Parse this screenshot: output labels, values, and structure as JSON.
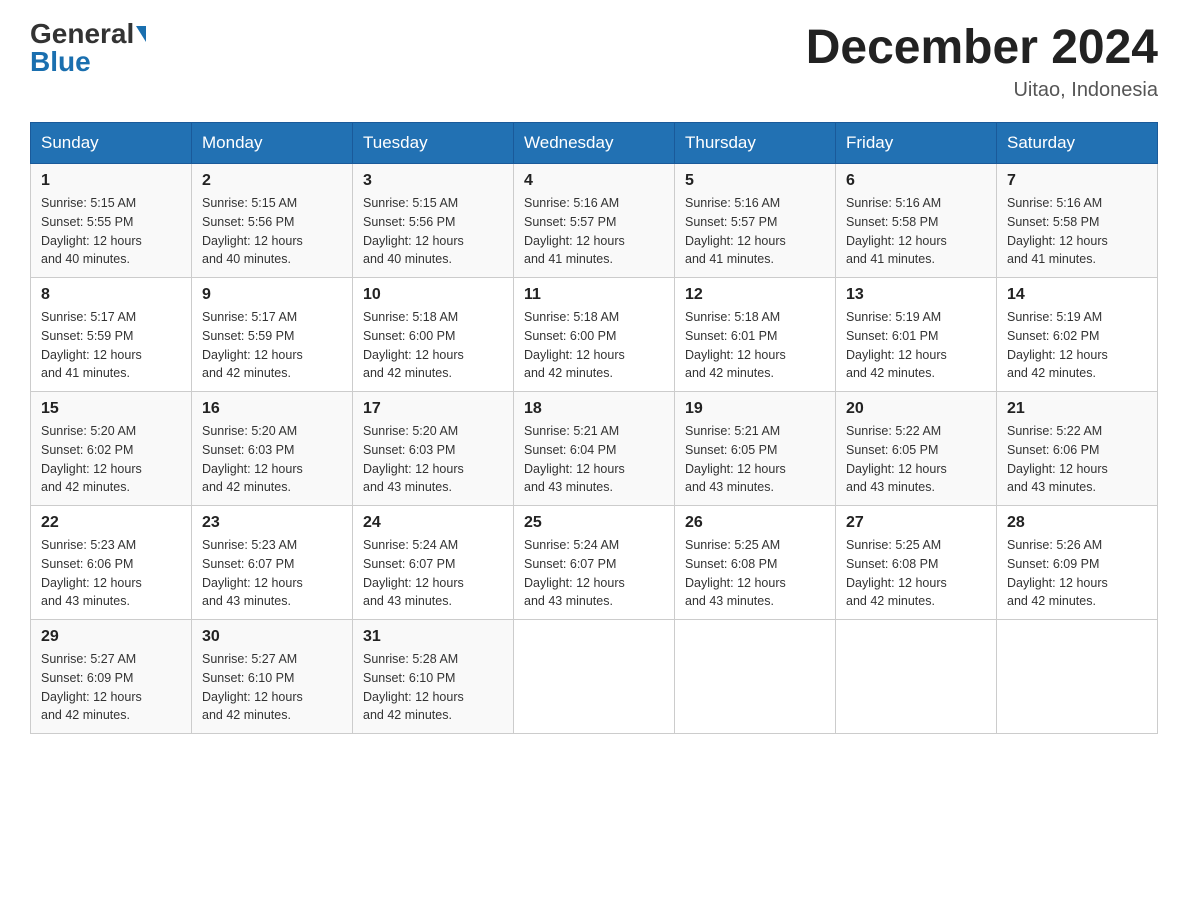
{
  "header": {
    "logo": {
      "general": "General",
      "blue": "Blue"
    },
    "title": "December 2024",
    "location": "Uitao, Indonesia"
  },
  "days_of_week": [
    "Sunday",
    "Monday",
    "Tuesday",
    "Wednesday",
    "Thursday",
    "Friday",
    "Saturday"
  ],
  "weeks": [
    [
      {
        "day": "1",
        "sunrise": "5:15 AM",
        "sunset": "5:55 PM",
        "daylight": "12 hours and 40 minutes."
      },
      {
        "day": "2",
        "sunrise": "5:15 AM",
        "sunset": "5:56 PM",
        "daylight": "12 hours and 40 minutes."
      },
      {
        "day": "3",
        "sunrise": "5:15 AM",
        "sunset": "5:56 PM",
        "daylight": "12 hours and 40 minutes."
      },
      {
        "day": "4",
        "sunrise": "5:16 AM",
        "sunset": "5:57 PM",
        "daylight": "12 hours and 41 minutes."
      },
      {
        "day": "5",
        "sunrise": "5:16 AM",
        "sunset": "5:57 PM",
        "daylight": "12 hours and 41 minutes."
      },
      {
        "day": "6",
        "sunrise": "5:16 AM",
        "sunset": "5:58 PM",
        "daylight": "12 hours and 41 minutes."
      },
      {
        "day": "7",
        "sunrise": "5:16 AM",
        "sunset": "5:58 PM",
        "daylight": "12 hours and 41 minutes."
      }
    ],
    [
      {
        "day": "8",
        "sunrise": "5:17 AM",
        "sunset": "5:59 PM",
        "daylight": "12 hours and 41 minutes."
      },
      {
        "day": "9",
        "sunrise": "5:17 AM",
        "sunset": "5:59 PM",
        "daylight": "12 hours and 42 minutes."
      },
      {
        "day": "10",
        "sunrise": "5:18 AM",
        "sunset": "6:00 PM",
        "daylight": "12 hours and 42 minutes."
      },
      {
        "day": "11",
        "sunrise": "5:18 AM",
        "sunset": "6:00 PM",
        "daylight": "12 hours and 42 minutes."
      },
      {
        "day": "12",
        "sunrise": "5:18 AM",
        "sunset": "6:01 PM",
        "daylight": "12 hours and 42 minutes."
      },
      {
        "day": "13",
        "sunrise": "5:19 AM",
        "sunset": "6:01 PM",
        "daylight": "12 hours and 42 minutes."
      },
      {
        "day": "14",
        "sunrise": "5:19 AM",
        "sunset": "6:02 PM",
        "daylight": "12 hours and 42 minutes."
      }
    ],
    [
      {
        "day": "15",
        "sunrise": "5:20 AM",
        "sunset": "6:02 PM",
        "daylight": "12 hours and 42 minutes."
      },
      {
        "day": "16",
        "sunrise": "5:20 AM",
        "sunset": "6:03 PM",
        "daylight": "12 hours and 42 minutes."
      },
      {
        "day": "17",
        "sunrise": "5:20 AM",
        "sunset": "6:03 PM",
        "daylight": "12 hours and 43 minutes."
      },
      {
        "day": "18",
        "sunrise": "5:21 AM",
        "sunset": "6:04 PM",
        "daylight": "12 hours and 43 minutes."
      },
      {
        "day": "19",
        "sunrise": "5:21 AM",
        "sunset": "6:05 PM",
        "daylight": "12 hours and 43 minutes."
      },
      {
        "day": "20",
        "sunrise": "5:22 AM",
        "sunset": "6:05 PM",
        "daylight": "12 hours and 43 minutes."
      },
      {
        "day": "21",
        "sunrise": "5:22 AM",
        "sunset": "6:06 PM",
        "daylight": "12 hours and 43 minutes."
      }
    ],
    [
      {
        "day": "22",
        "sunrise": "5:23 AM",
        "sunset": "6:06 PM",
        "daylight": "12 hours and 43 minutes."
      },
      {
        "day": "23",
        "sunrise": "5:23 AM",
        "sunset": "6:07 PM",
        "daylight": "12 hours and 43 minutes."
      },
      {
        "day": "24",
        "sunrise": "5:24 AM",
        "sunset": "6:07 PM",
        "daylight": "12 hours and 43 minutes."
      },
      {
        "day": "25",
        "sunrise": "5:24 AM",
        "sunset": "6:07 PM",
        "daylight": "12 hours and 43 minutes."
      },
      {
        "day": "26",
        "sunrise": "5:25 AM",
        "sunset": "6:08 PM",
        "daylight": "12 hours and 43 minutes."
      },
      {
        "day": "27",
        "sunrise": "5:25 AM",
        "sunset": "6:08 PM",
        "daylight": "12 hours and 42 minutes."
      },
      {
        "day": "28",
        "sunrise": "5:26 AM",
        "sunset": "6:09 PM",
        "daylight": "12 hours and 42 minutes."
      }
    ],
    [
      {
        "day": "29",
        "sunrise": "5:27 AM",
        "sunset": "6:09 PM",
        "daylight": "12 hours and 42 minutes."
      },
      {
        "day": "30",
        "sunrise": "5:27 AM",
        "sunset": "6:10 PM",
        "daylight": "12 hours and 42 minutes."
      },
      {
        "day": "31",
        "sunrise": "5:28 AM",
        "sunset": "6:10 PM",
        "daylight": "12 hours and 42 minutes."
      },
      null,
      null,
      null,
      null
    ]
  ]
}
